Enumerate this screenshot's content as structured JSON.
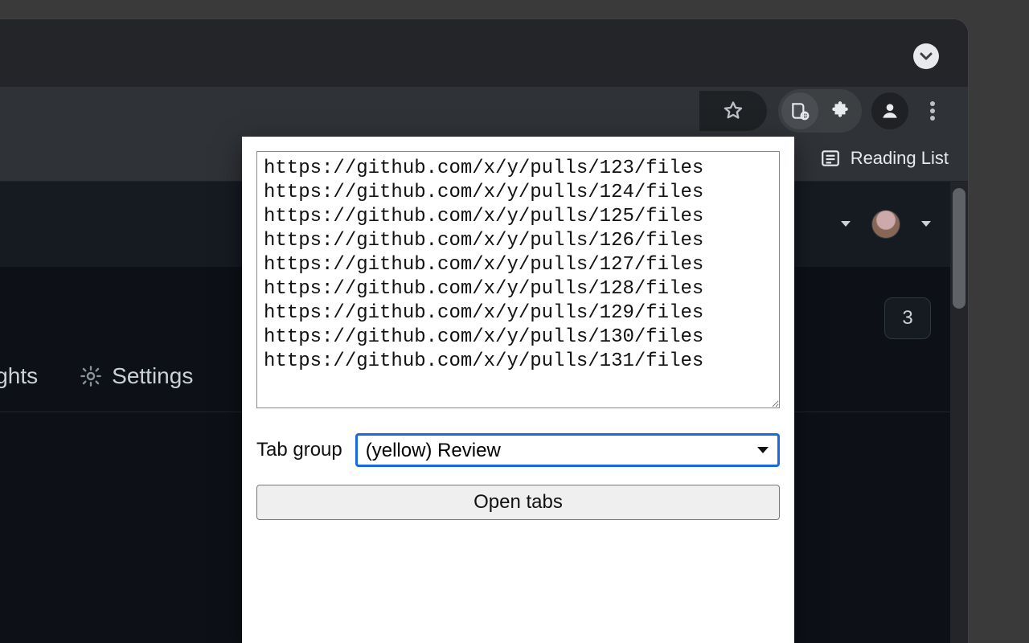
{
  "browser": {
    "reading_list_label": "Reading List"
  },
  "page": {
    "badge_value": "3",
    "tabs": {
      "insights_label": "ights",
      "settings_label": "Settings"
    }
  },
  "popup": {
    "urls_text": "https://github.com/x/y/pulls/123/files\nhttps://github.com/x/y/pulls/124/files\nhttps://github.com/x/y/pulls/125/files\nhttps://github.com/x/y/pulls/126/files\nhttps://github.com/x/y/pulls/127/files\nhttps://github.com/x/y/pulls/128/files\nhttps://github.com/x/y/pulls/129/files\nhttps://github.com/x/y/pulls/130/files\nhttps://github.com/x/y/pulls/131/files",
    "tab_group_label": "Tab group",
    "tab_group_selected": "(yellow) Review",
    "open_button_label": "Open tabs"
  }
}
